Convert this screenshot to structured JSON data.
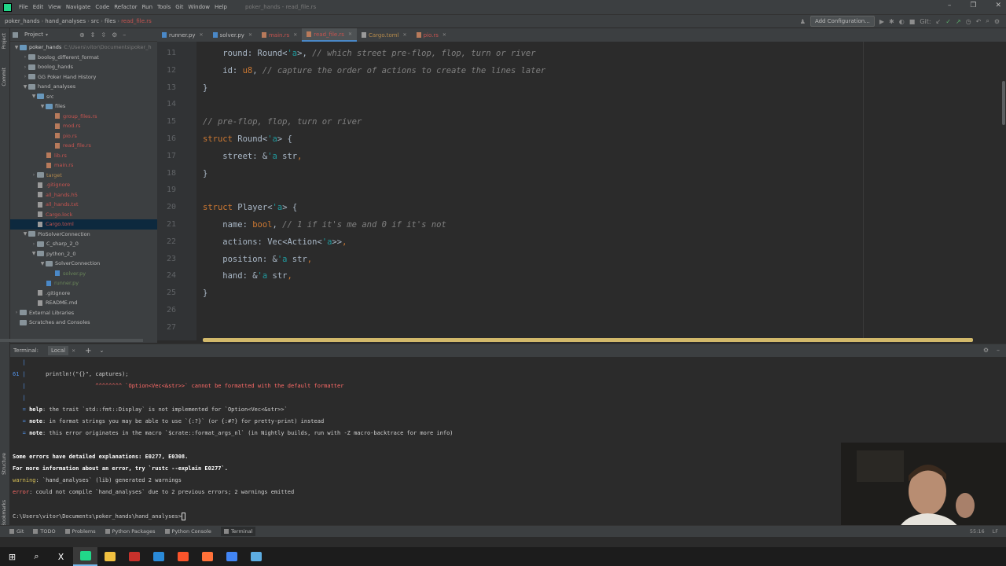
{
  "menubar": {
    "items": [
      "File",
      "Edit",
      "View",
      "Navigate",
      "Code",
      "Refactor",
      "Run",
      "Tools",
      "Git",
      "Window",
      "Help"
    ],
    "window_title": "poker_hands - read_file.rs"
  },
  "navbar": {
    "breadcrumbs": [
      "poker_hands",
      "hand_analyses",
      "src",
      "files",
      "read_file.rs"
    ],
    "add_configuration": "Add Configuration...",
    "git_label": "Git:"
  },
  "project": {
    "title": "Project",
    "tree": [
      {
        "indent": 0,
        "arrow": "▼",
        "icon": "folder blue",
        "label": "poker_hands",
        "cls": "bold",
        "path": "C:\\Users\\vitor\\Documents\\poker_h"
      },
      {
        "indent": 1,
        "arrow": "›",
        "icon": "folder",
        "label": "boolog_different_format",
        "cls": ""
      },
      {
        "indent": 1,
        "arrow": "›",
        "icon": "folder",
        "label": "boolog_hands",
        "cls": ""
      },
      {
        "indent": 1,
        "arrow": "›",
        "icon": "folder",
        "label": "GG Poker Hand History",
        "cls": ""
      },
      {
        "indent": 1,
        "arrow": "▼",
        "icon": "folder",
        "label": "hand_analyses",
        "cls": ""
      },
      {
        "indent": 2,
        "arrow": "▼",
        "icon": "folder blue",
        "label": "src",
        "cls": ""
      },
      {
        "indent": 3,
        "arrow": "▼",
        "icon": "folder blue",
        "label": "files",
        "cls": ""
      },
      {
        "indent": 4,
        "arrow": "",
        "icon": "file",
        "label": "group_files.rs",
        "cls": "red"
      },
      {
        "indent": 4,
        "arrow": "",
        "icon": "file",
        "label": "mod.rs",
        "cls": "red"
      },
      {
        "indent": 4,
        "arrow": "",
        "icon": "file",
        "label": "pio.rs",
        "cls": "red"
      },
      {
        "indent": 4,
        "arrow": "",
        "icon": "file",
        "label": "read_file.rs",
        "cls": "red"
      },
      {
        "indent": 3,
        "arrow": "",
        "icon": "file",
        "label": "lib.rs",
        "cls": "red"
      },
      {
        "indent": 3,
        "arrow": "",
        "icon": "file",
        "label": "main.rs",
        "cls": "red"
      },
      {
        "indent": 2,
        "arrow": "›",
        "icon": "folder",
        "label": "target",
        "cls": "orange"
      },
      {
        "indent": 2,
        "arrow": "",
        "icon": "txt",
        "label": ".gitignore",
        "cls": "red"
      },
      {
        "indent": 2,
        "arrow": "",
        "icon": "txt",
        "label": "all_hands.h5",
        "cls": "red"
      },
      {
        "indent": 2,
        "arrow": "",
        "icon": "txt",
        "label": "all_hands.txt",
        "cls": "red"
      },
      {
        "indent": 2,
        "arrow": "",
        "icon": "txt",
        "label": "Cargo.lock",
        "cls": "red"
      },
      {
        "indent": 2,
        "arrow": "",
        "icon": "txt",
        "label": "Cargo.toml",
        "cls": "red",
        "selected": true
      },
      {
        "indent": 1,
        "arrow": "▼",
        "icon": "folder",
        "label": "PioSolverConnection",
        "cls": ""
      },
      {
        "indent": 2,
        "arrow": "›",
        "icon": "folder",
        "label": "C_sharp_2_0",
        "cls": ""
      },
      {
        "indent": 2,
        "arrow": "▼",
        "icon": "folder",
        "label": "python_2_0",
        "cls": ""
      },
      {
        "indent": 3,
        "arrow": "▼",
        "icon": "folder",
        "label": "SolverConnection",
        "cls": ""
      },
      {
        "indent": 4,
        "arrow": "",
        "icon": "py",
        "label": "solver.py",
        "cls": "green"
      },
      {
        "indent": 3,
        "arrow": "",
        "icon": "py",
        "label": "runner.py",
        "cls": "green"
      },
      {
        "indent": 2,
        "arrow": "",
        "icon": "txt",
        "label": ".gitignore",
        "cls": ""
      },
      {
        "indent": 2,
        "arrow": "",
        "icon": "txt",
        "label": "README.md",
        "cls": ""
      },
      {
        "indent": 0,
        "arrow": "›",
        "icon": "folder",
        "label": "External Libraries",
        "cls": ""
      },
      {
        "indent": 0,
        "arrow": "",
        "icon": "folder",
        "label": "Scratches and Consoles",
        "cls": ""
      }
    ]
  },
  "tabs": [
    {
      "label": "runner.py",
      "icon": "py",
      "cls": ""
    },
    {
      "label": "solver.py",
      "icon": "py",
      "cls": ""
    },
    {
      "label": "main.rs",
      "icon": "rs",
      "cls": "red"
    },
    {
      "label": "read_file.rs",
      "icon": "rs",
      "cls": "red",
      "active": true
    },
    {
      "label": "Cargo.toml",
      "icon": "toml",
      "cls": "orange"
    },
    {
      "label": "pio.rs",
      "icon": "rs",
      "cls": "red"
    }
  ],
  "code_lines": [
    {
      "n": "11",
      "tokens": [
        [
          "pl",
          "    round: "
        ],
        [
          "ty",
          "Round"
        ],
        [
          "pl",
          "<"
        ],
        [
          "lt",
          "'a"
        ],
        [
          "pl",
          ">, "
        ],
        [
          "cm",
          "// which street pre-flop, flop, turn or river"
        ]
      ]
    },
    {
      "n": "12",
      "tokens": [
        [
          "pl",
          "    id: "
        ],
        [
          "kw",
          "u8"
        ],
        [
          "pl",
          ", "
        ],
        [
          "cm",
          "// capture the order of actions to create the lines later"
        ]
      ]
    },
    {
      "n": "13",
      "tokens": [
        [
          "pl",
          "}"
        ]
      ]
    },
    {
      "n": "14",
      "tokens": []
    },
    {
      "n": "15",
      "tokens": [
        [
          "cm",
          "// pre-flop, flop, turn or river"
        ]
      ]
    },
    {
      "n": "16",
      "tokens": [
        [
          "kw",
          "struct "
        ],
        [
          "ty",
          "Round"
        ],
        [
          "pl",
          "<"
        ],
        [
          "lt",
          "'a"
        ],
        [
          "pl",
          "> {"
        ]
      ]
    },
    {
      "n": "17",
      "tokens": [
        [
          "pl",
          "    street: &"
        ],
        [
          "lt",
          "'a"
        ],
        [
          "pl",
          " str"
        ],
        [
          "kw",
          ","
        ]
      ]
    },
    {
      "n": "18",
      "tokens": [
        [
          "pl",
          "}"
        ]
      ]
    },
    {
      "n": "19",
      "tokens": []
    },
    {
      "n": "20",
      "tokens": [
        [
          "kw",
          "struct "
        ],
        [
          "ty",
          "Player"
        ],
        [
          "pl",
          "<"
        ],
        [
          "lt",
          "'a"
        ],
        [
          "pl",
          "> {"
        ]
      ]
    },
    {
      "n": "21",
      "tokens": [
        [
          "pl",
          "    name: "
        ],
        [
          "kw",
          "bool"
        ],
        [
          "pl",
          ", "
        ],
        [
          "cm",
          "// 1 if it's me and 0 if it's not"
        ]
      ]
    },
    {
      "n": "22",
      "tokens": [
        [
          "pl",
          "    actions: "
        ],
        [
          "ty",
          "Vec"
        ],
        [
          "pl",
          "<"
        ],
        [
          "ty",
          "Action"
        ],
        [
          "pl",
          "<"
        ],
        [
          "lt",
          "'a"
        ],
        [
          "pl",
          ">>"
        ],
        [
          "kw",
          ","
        ]
      ]
    },
    {
      "n": "23",
      "tokens": [
        [
          "pl",
          "    position: &"
        ],
        [
          "lt",
          "'a"
        ],
        [
          "pl",
          " str"
        ],
        [
          "kw",
          ","
        ]
      ]
    },
    {
      "n": "24",
      "tokens": [
        [
          "pl",
          "    hand: &"
        ],
        [
          "lt",
          "'a"
        ],
        [
          "pl",
          " str"
        ],
        [
          "kw",
          ","
        ]
      ]
    },
    {
      "n": "25",
      "tokens": [
        [
          "pl",
          "}"
        ]
      ]
    },
    {
      "n": "26",
      "tokens": []
    },
    {
      "n": "27",
      "tokens": []
    }
  ],
  "terminal": {
    "title": "Terminal:",
    "tab": "Local",
    "lines": [
      {
        "parts": [
          [
            "blue",
            "   |"
          ]
        ]
      },
      {
        "parts": [
          [
            "blue",
            "61 |"
          ],
          [
            "plain",
            "      println!(\"{}\", captures);"
          ]
        ]
      },
      {
        "parts": [
          [
            "blue",
            "   |"
          ],
          [
            "pink",
            "                     ^^^^^^^^ `Option<Vec<&str>>` cannot be formatted with the default formatter"
          ]
        ]
      },
      {
        "parts": [
          [
            "blue",
            "   |"
          ]
        ]
      },
      {
        "parts": [
          [
            "blue",
            "   = "
          ],
          [
            "bold",
            "help"
          ],
          [
            "plain",
            ": the trait `std::fmt::Display` is not implemented for `Option<Vec<&str>>`"
          ]
        ]
      },
      {
        "parts": [
          [
            "blue",
            "   = "
          ],
          [
            "bold",
            "note"
          ],
          [
            "plain",
            ": in format strings you may be able to use `{:?}` (or {:#?} for pretty-print) instead"
          ]
        ]
      },
      {
        "parts": [
          [
            "blue",
            "   = "
          ],
          [
            "bold",
            "note"
          ],
          [
            "plain",
            ": this error originates in the macro `$crate::format_args_nl` (in Nightly builds, run with -Z macro-backtrace for more info)"
          ]
        ]
      },
      {
        "parts": []
      },
      {
        "parts": [
          [
            "bold",
            "Some errors have detailed explanations: E0277, E0308."
          ]
        ]
      },
      {
        "parts": [
          [
            "bold",
            "For more information about an error, try `rustc --explain E0277`."
          ]
        ]
      },
      {
        "parts": [
          [
            "yellow",
            "warning"
          ],
          [
            "plain",
            ": `hand_analyses` (lib) generated 2 warnings"
          ]
        ]
      },
      {
        "parts": [
          [
            "pink",
            "error"
          ],
          [
            "plain",
            ": could not compile `hand_analyses` due to 2 previous errors; 2 warnings emitted"
          ]
        ]
      },
      {
        "parts": []
      },
      {
        "parts": [
          [
            "plain",
            "C:\\Users\\vitor\\Documents\\poker_hands\\hand_analyses>"
          ]
        ],
        "cursor": true
      }
    ]
  },
  "bottom_tools": [
    {
      "label": "Git"
    },
    {
      "label": "TODO"
    },
    {
      "label": "Problems"
    },
    {
      "label": "Python Packages"
    },
    {
      "label": "Python Console"
    },
    {
      "label": "Terminal",
      "active": true
    }
  ],
  "status": {
    "position": "55:16",
    "line_ending": "LF"
  },
  "taskbar": [
    {
      "name": "taskbar-start",
      "glyph": "⊞",
      "color": "#ffffff"
    },
    {
      "name": "taskbar-search",
      "glyph": "⌕",
      "color": "#ffffff"
    },
    {
      "name": "taskbar-app-x",
      "glyph": "X",
      "color": "#ffffff"
    },
    {
      "name": "taskbar-pycharm",
      "glyph": "",
      "color": "#21d789",
      "active": true
    },
    {
      "name": "taskbar-explorer",
      "glyph": "",
      "color": "#f0c040"
    },
    {
      "name": "taskbar-app-red",
      "glyph": "",
      "color": "#c8312b"
    },
    {
      "name": "taskbar-vscode",
      "glyph": "",
      "color": "#2a8ad8"
    },
    {
      "name": "taskbar-brave",
      "glyph": "",
      "color": "#fb542b"
    },
    {
      "name": "taskbar-firefox",
      "glyph": "",
      "color": "#ff7139"
    },
    {
      "name": "taskbar-chrome",
      "glyph": "",
      "color": "#4285f4"
    },
    {
      "name": "taskbar-app-blue",
      "glyph": "",
      "color": "#5dade2"
    }
  ]
}
